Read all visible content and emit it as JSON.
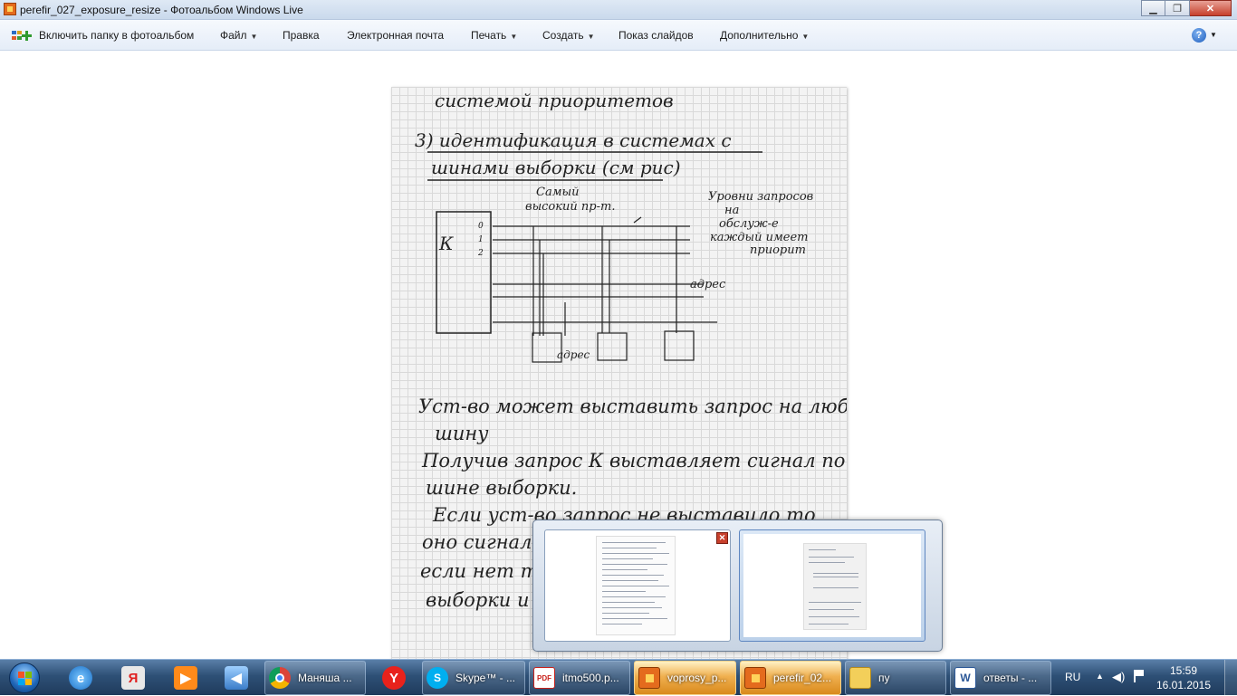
{
  "window": {
    "title": "perefir_027_exposure_resize - Фотоальбом Windows Live",
    "minimize_glyph": "▁",
    "maximize_glyph": "❐",
    "close_glyph": "✕"
  },
  "menu": {
    "add_folder": "Включить папку в фотоальбом",
    "file": "Файл",
    "edit": "Правка",
    "email": "Электронная почта",
    "print": "Печать",
    "create": "Создать",
    "slideshow": "Показ слайдов",
    "more": "Дополнительно",
    "help_glyph": "?"
  },
  "photo": {
    "handwritten_lines": [
      "системой приоритетов",
      "3) идентификация в системах с",
      "шинами выборки (см рис)",
      "Самый",
      "высокий пр-т.",
      "Уровни запросов",
      "на",
      "обслуж-е",
      "каждый имеет",
      "приорит",
      "К",
      "0",
      "1",
      "2",
      "адрес",
      "адрес",
      "Уст-во может выставить запрос на любую",
      "шину",
      "Получив запрос К выставляет сигнал по",
      "шине выборки.",
      "Если уст-во запрос не выставило то",
      "оно сигнал",
      "если нет т",
      "выборки и"
    ]
  },
  "taskbar": {
    "tasks": [
      {
        "label": "Маняша ...",
        "icon": "chrome-icon"
      },
      {
        "label": "Skype™ - ...",
        "icon": "skype-icon"
      },
      {
        "label": "itmo500.p...",
        "icon": "pdf-icon"
      },
      {
        "label": "voprosy_p...",
        "icon": "photo-gallery-icon"
      },
      {
        "label": "perefir_02...",
        "icon": "photo-gallery-icon"
      },
      {
        "label": "пу",
        "icon": "folder-icon"
      },
      {
        "label": "ответы - ...",
        "icon": "word-icon"
      }
    ],
    "language": "RU",
    "time": "15:59",
    "date": "16.01.2015"
  }
}
